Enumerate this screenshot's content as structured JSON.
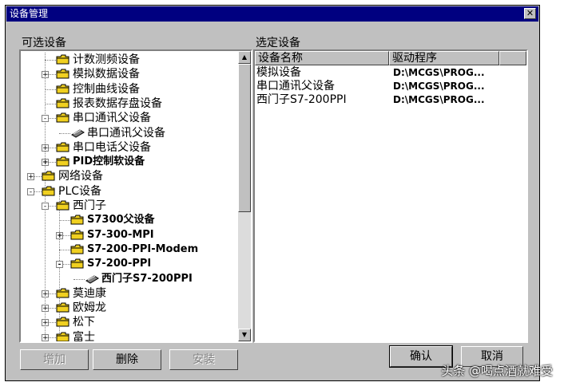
{
  "window": {
    "title": "设备管理",
    "close_glyph": "✕"
  },
  "available": {
    "label": "可选设备",
    "items": [
      {
        "label": "计数测频设备",
        "expander": ""
      },
      {
        "label": "模拟数据设备",
        "expander": "+"
      },
      {
        "label": "控制曲线设备",
        "expander": ""
      },
      {
        "label": "报表数据存盘设备",
        "expander": ""
      },
      {
        "label": "串口通讯父设备",
        "expander": "-"
      },
      {
        "label": "串口通讯父设备",
        "expander": ""
      },
      {
        "label": "串口电话父设备",
        "expander": "+"
      },
      {
        "label": "PID控制软设备",
        "expander": "+"
      },
      {
        "label": "网络设备",
        "expander": "+"
      },
      {
        "label": "PLC设备",
        "expander": "-"
      },
      {
        "label": "西门子",
        "expander": "-"
      },
      {
        "label": "S7300父设备",
        "expander": ""
      },
      {
        "label": "S7-300-MPI",
        "expander": "+"
      },
      {
        "label": "S7-200-PPI-Modem",
        "expander": ""
      },
      {
        "label": "S7-200-PPI",
        "expander": "-"
      },
      {
        "label": "西门子S7-200PPI",
        "expander": ""
      },
      {
        "label": "莫迪康",
        "expander": "+"
      },
      {
        "label": "欧姆龙",
        "expander": "+"
      },
      {
        "label": "松下",
        "expander": "+"
      },
      {
        "label": "富士",
        "expander": "+"
      }
    ],
    "scroll_up": "▲",
    "scroll_down": "▼"
  },
  "selected": {
    "label": "选定设备",
    "columns": [
      "设备名称",
      "驱动程序"
    ],
    "rows": [
      [
        "模拟设备",
        "D:\\MCGS\\PROG..."
      ],
      [
        "串口通讯父设备",
        "D:\\MCGS\\PROG..."
      ],
      [
        "西门子S7-200PPI",
        "D:\\MCGS\\PROG..."
      ]
    ]
  },
  "buttons": {
    "add": "增加",
    "delete": "删除",
    "install": "安装",
    "ok": "确认",
    "cancel": "取消"
  },
  "watermark": "头条 @喝点酒就难受",
  "colors": {
    "titlebar": "#000080",
    "face": "#c0c0c0",
    "folder": "#f0d020"
  }
}
